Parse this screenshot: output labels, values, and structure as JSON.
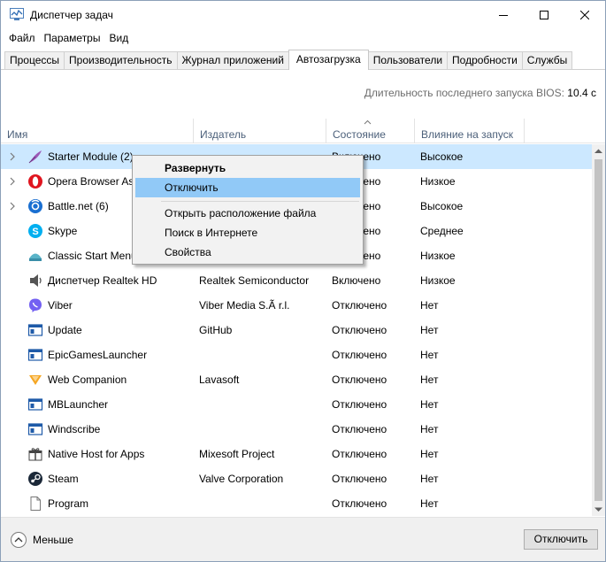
{
  "window": {
    "title": "Диспетчер задач"
  },
  "menu": [
    "Файл",
    "Параметры",
    "Вид"
  ],
  "tabs": [
    {
      "label": "Процессы",
      "active": false
    },
    {
      "label": "Производительность",
      "active": false
    },
    {
      "label": "Журнал приложений",
      "active": false
    },
    {
      "label": "Автозагрузка",
      "active": true
    },
    {
      "label": "Пользователи",
      "active": false
    },
    {
      "label": "Подробности",
      "active": false
    },
    {
      "label": "Службы",
      "active": false
    }
  ],
  "bios": {
    "label": "Длительность последнего запуска BIOS:",
    "value": "10.4 с"
  },
  "columns": {
    "name": "Имя",
    "publisher": "Издатель",
    "state": "Состояние",
    "impact": "Влияние на запуск"
  },
  "rows": [
    {
      "name": "Starter Module (2)",
      "publisher": "",
      "state": "Включено",
      "impact": "Высокое",
      "expandable": true,
      "icon": "feather-icon"
    },
    {
      "name": "Opera Browser Assistant",
      "publisher": "",
      "state": "Включено",
      "impact": "Низкое",
      "expandable": true,
      "icon": "opera-icon"
    },
    {
      "name": "Battle.net (6)",
      "publisher": "",
      "state": "Включено",
      "impact": "Высокое",
      "expandable": true,
      "icon": "battlenet-icon"
    },
    {
      "name": "Skype",
      "publisher": "",
      "state": "Включено",
      "impact": "Среднее",
      "expandable": false,
      "icon": "skype-icon"
    },
    {
      "name": "Classic Start Menu",
      "publisher": "",
      "state": "Включено",
      "impact": "Низкое",
      "expandable": false,
      "icon": "shell-icon"
    },
    {
      "name": "Диспетчер Realtek HD",
      "publisher": "Realtek Semiconductor",
      "state": "Включено",
      "impact": "Низкое",
      "expandable": false,
      "icon": "speaker-icon"
    },
    {
      "name": "Viber",
      "publisher": "Viber Media S.Ã  r.l.",
      "state": "Отключено",
      "impact": "Нет",
      "expandable": false,
      "icon": "viber-icon"
    },
    {
      "name": "Update",
      "publisher": "GitHub",
      "state": "Отключено",
      "impact": "Нет",
      "expandable": false,
      "icon": "app-window-icon"
    },
    {
      "name": "EpicGamesLauncher",
      "publisher": "",
      "state": "Отключено",
      "impact": "Нет",
      "expandable": false,
      "icon": "app-window-icon"
    },
    {
      "name": "Web Companion",
      "publisher": "Lavasoft",
      "state": "Отключено",
      "impact": "Нет",
      "expandable": false,
      "icon": "web-companion-icon"
    },
    {
      "name": "MBLauncher",
      "publisher": "",
      "state": "Отключено",
      "impact": "Нет",
      "expandable": false,
      "icon": "app-window-icon"
    },
    {
      "name": "Windscribe",
      "publisher": "",
      "state": "Отключено",
      "impact": "Нет",
      "expandable": false,
      "icon": "app-window-icon"
    },
    {
      "name": "Native Host for Apps",
      "publisher": "Mixesoft Project",
      "state": "Отключено",
      "impact": "Нет",
      "expandable": false,
      "icon": "gift-icon"
    },
    {
      "name": "Steam",
      "publisher": "Valve Corporation",
      "state": "Отключено",
      "impact": "Нет",
      "expandable": false,
      "icon": "steam-icon"
    },
    {
      "name": "Program",
      "publisher": "",
      "state": "Отключено",
      "impact": "Нет",
      "expandable": false,
      "icon": "file-icon"
    }
  ],
  "context_menu": {
    "expand": "Развернуть",
    "disable": "Отключить",
    "open_location": "Открыть расположение файла",
    "search_online": "Поиск в Интернете",
    "properties": "Свойства"
  },
  "footer": {
    "less_label": "Меньше",
    "disable_button": "Отключить"
  },
  "colors": {
    "selected_row": "#cce8ff",
    "menu_highlight": "#91c9f7",
    "header_text": "#4c607a"
  }
}
